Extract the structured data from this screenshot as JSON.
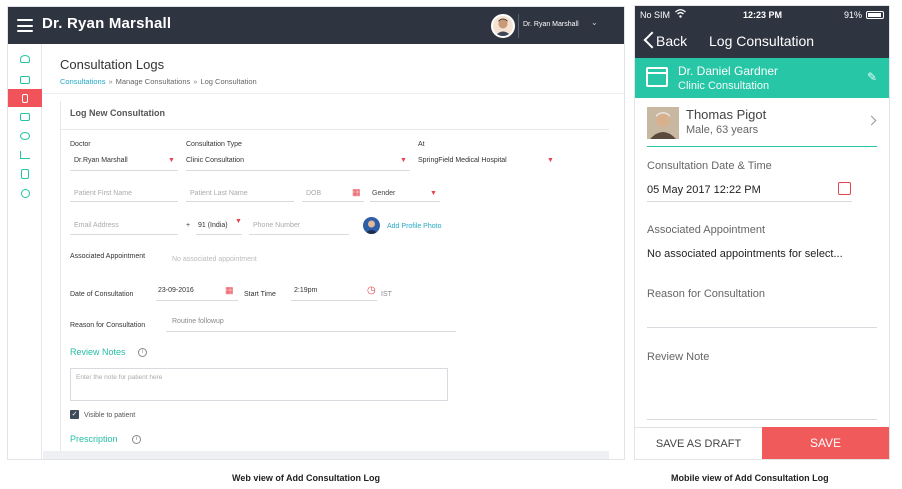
{
  "colors": {
    "header_dark": "#2f3441",
    "teal_accent": "#26c6a6",
    "link_blue": "#24a9c4",
    "save_red": "#f05a5b",
    "sidebar_active": "#f0535a"
  },
  "web": {
    "header": {
      "title": "Dr. Ryan Marshall",
      "user_name": "Dr. Ryan Marshall",
      "menu_icon": "hamburger-icon",
      "chevron_icon": "chevron-down-icon"
    },
    "page_title": "Consultation Logs",
    "breadcrumb": [
      "Consultations",
      "Manage Consultations",
      "Log Consultation"
    ],
    "breadcrumb_separator": "»",
    "form": {
      "section_title": "Log New Consultation",
      "doctor_label": "Doctor",
      "doctor_value": "Dr.Ryan Marshall",
      "consultation_type_label": "Consultation Type",
      "consultation_type_value": "Clinic Consultation",
      "at_label": "At",
      "at_value": "SpringField Medical Hospital",
      "first_name_placeholder": "Patient First Name",
      "last_name_placeholder": "Patient Last Name",
      "dob_placeholder": "DOB",
      "gender_placeholder": "Gender",
      "email_placeholder": "Email Address",
      "phone_prefix_plus": "+",
      "phone_country": "91 (India)",
      "phone_placeholder": "Phone Number",
      "add_photo_label": "Add Profile Photo",
      "associated_appointment_label": "Associated Appointment",
      "associated_appointment_value": "No associated appointment",
      "date_label": "Date of Consultation",
      "date_value": "23-09-2016",
      "start_time_label": "Start Time",
      "start_time_value": "2:19pm",
      "timezone": "IST",
      "reason_label": "Reason for Consultation",
      "reason_value": "Routine followup",
      "review_notes_title": "Review Notes",
      "review_notes_placeholder": "Enter the note for patient here",
      "visible_to_patient_label": "Visible to patient",
      "visible_to_patient_checked": true,
      "prescription_title": "Prescription"
    },
    "sidebar_icons": [
      "stethoscope-icon",
      "calendar-icon",
      "consultation-icon",
      "monitor-icon",
      "chat-icon",
      "chart-icon",
      "calculator-icon",
      "settings-icon"
    ],
    "sidebar_active_index": 2
  },
  "mobile": {
    "status": {
      "carrier": "No SIM",
      "time": "12:23 PM",
      "battery": "91%"
    },
    "nav": {
      "back_label": "Back",
      "title": "Log Consultation"
    },
    "doctor": {
      "name": "Dr. Daniel Gardner",
      "type": "Clinic Consultation"
    },
    "patient": {
      "name": "Thomas Pigot",
      "details": "Male, 63 years"
    },
    "datetime_label": "Consultation Date & Time",
    "datetime_value": "05 May 2017 12:22 PM",
    "appointment_label": "Associated Appointment",
    "appointment_value": "No associated appointments for select...",
    "reason_label": "Reason for Consultation",
    "review_note_label": "Review Note",
    "save_draft_label": "SAVE AS DRAFT",
    "save_label": "SAVE"
  },
  "captions": {
    "web": "Web view of Add Consultation Log",
    "mobile": "Mobile view of Add Consultation Log"
  }
}
